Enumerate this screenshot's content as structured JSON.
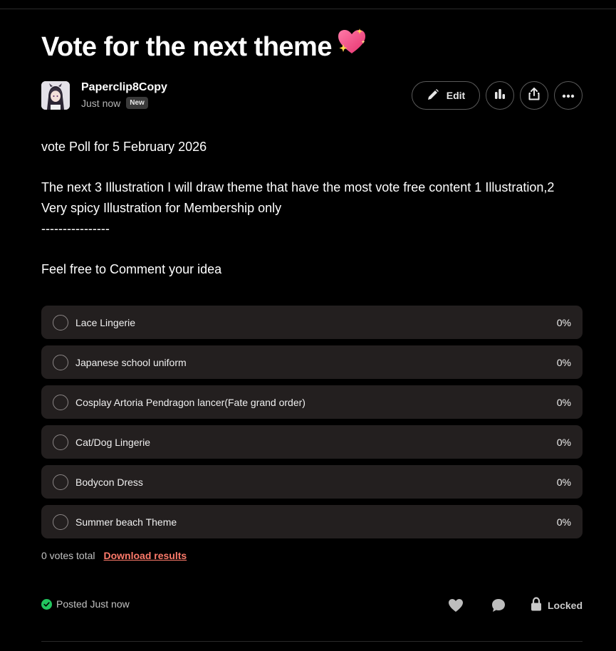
{
  "post": {
    "title": "Vote for the next theme",
    "title_emoji": "sparkling-heart-icon",
    "author": {
      "name": "Paperclip8Copy",
      "time": "Just now",
      "badge": "New"
    },
    "actions": {
      "edit_label": "Edit",
      "icons": [
        "pencil-icon",
        "stats-icon",
        "share-icon",
        "more-icon"
      ]
    },
    "body": {
      "line1": "vote Poll for 5 February 2026",
      "line2": "The next 3 Illustration I will draw theme that have the most vote free content 1 Illustration,2 Very spicy Illustration for Membership only",
      "line3": "----------------",
      "line4": "Feel free to Comment your idea"
    },
    "poll": {
      "options": [
        {
          "label": "Lace Lingerie",
          "percent": "0%"
        },
        {
          "label": "Japanese school uniform",
          "percent": "0%"
        },
        {
          "label": "Cosplay Artoria Pendragon lancer(Fate grand order)",
          "percent": "0%"
        },
        {
          "label": "Cat/Dog Lingerie",
          "percent": "0%"
        },
        {
          "label": "Bodycon Dress",
          "percent": "0%"
        },
        {
          "label": "Summer beach Theme",
          "percent": "0%"
        }
      ],
      "votes_total": "0 votes total",
      "download_label": "Download results"
    },
    "footer": {
      "posted": "Posted Just now",
      "locked": "Locked"
    }
  },
  "colors": {
    "background": "#000000",
    "option_bg": "#231f1f",
    "accent_link": "#ff7b6b",
    "success": "#22c55e"
  }
}
